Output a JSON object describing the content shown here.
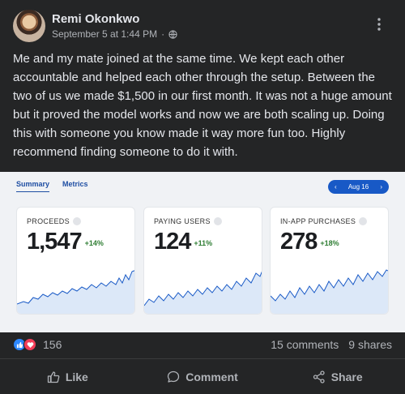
{
  "post": {
    "author": "Remi Okonkwo",
    "timestamp": "September 5 at 1:44 PM",
    "separator": "·",
    "audience_icon": "globe-icon",
    "more_icon": "more-vertical-icon",
    "text": "Me and my mate joined at the same time. We kept each other accountable and helped each other through the setup. Between the two of us we made $1,500 in our first month. It was not a huge amount but it proved the model works and now we are both scaling up. Doing this with someone you know made it way more fun too. Highly recommend finding someone to do it with."
  },
  "dashboard": {
    "tabs": [
      {
        "label": "Summary",
        "active": true
      },
      {
        "label": "Metrics",
        "active": false
      }
    ],
    "date_prev": "‹",
    "date_label": "Aug 16",
    "date_next": "›",
    "accent": "#1859c6",
    "cards": [
      {
        "label": "PROCEEDS",
        "value": "1,547",
        "delta": "+14%"
      },
      {
        "label": "PAYING USERS",
        "value": "124",
        "delta": "+11%"
      },
      {
        "label": "IN-APP PURCHASES",
        "value": "278",
        "delta": "+18%"
      }
    ]
  },
  "footer": {
    "reaction_icons": [
      "like-reaction-icon",
      "love-reaction-icon"
    ],
    "reaction_count": "156",
    "comments": "15 comments",
    "shares": "9 shares",
    "like_label": "Like",
    "comment_label": "Comment",
    "share_label": "Share",
    "like_color": "#2d88ff",
    "love_color": "#f33e58"
  }
}
